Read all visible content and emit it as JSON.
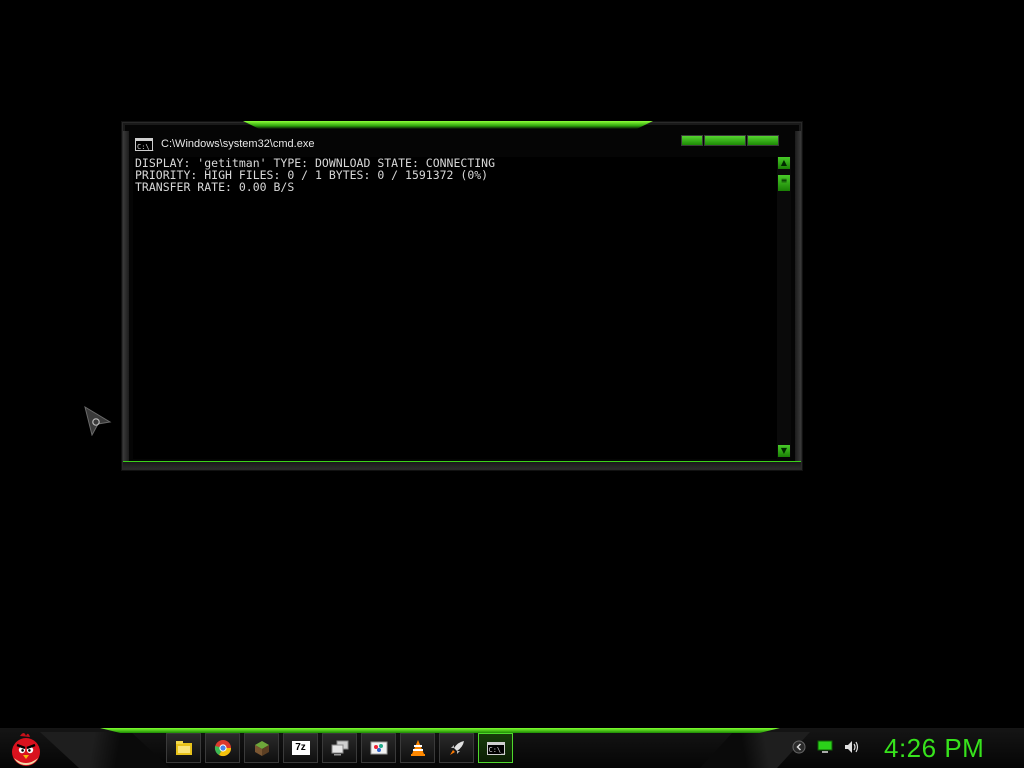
{
  "window": {
    "title": "C:\\Windows\\system32\\cmd.exe",
    "icon_text": "C:\\_",
    "console_lines": [
      "DISPLAY: 'getitman' TYPE: DOWNLOAD STATE: CONNECTING",
      "PRIORITY: HIGH FILES: 0 / 1 BYTES: 0 / 1591372 (0%)",
      "TRANSFER RATE: 0.00 B/S"
    ]
  },
  "taskbar": {
    "start_icon": "angry-bird-icon",
    "items": [
      {
        "name": "folder-icon",
        "active": false
      },
      {
        "name": "chrome-icon",
        "active": false
      },
      {
        "name": "minecraft-icon",
        "active": false
      },
      {
        "name": "7zip-icon",
        "active": false,
        "label": "7z"
      },
      {
        "name": "remote-desktop-icon",
        "active": false
      },
      {
        "name": "paint-icon",
        "active": false
      },
      {
        "name": "vlc-icon",
        "active": false
      },
      {
        "name": "rocket-icon",
        "active": false
      },
      {
        "name": "cmd-icon",
        "active": true,
        "label": "C:\\_"
      }
    ],
    "tray_icons": [
      "notification-icon",
      "network-icon",
      "volume-icon"
    ],
    "clock": "4:26 PM"
  },
  "colors": {
    "accent": "#37e31c",
    "background": "#000000",
    "console_text": "#d8d8d8"
  }
}
